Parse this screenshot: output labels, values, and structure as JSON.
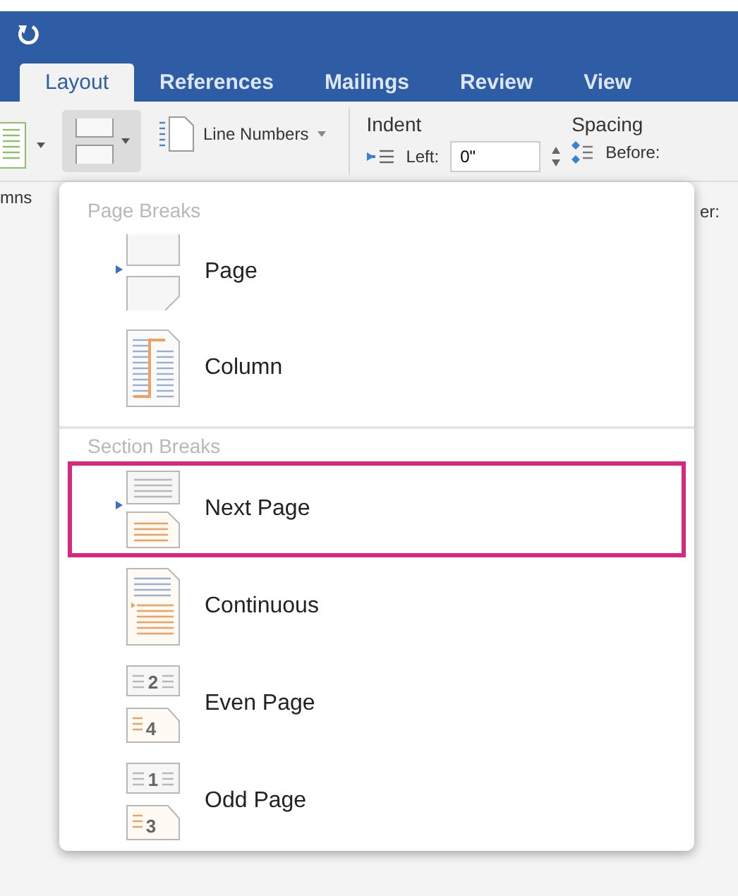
{
  "tabs": [
    {
      "label": "Layout",
      "selected": true
    },
    {
      "label": "References",
      "selected": false
    },
    {
      "label": "Mailings",
      "selected": false
    },
    {
      "label": "Review",
      "selected": false
    },
    {
      "label": "View",
      "selected": false
    }
  ],
  "ribbon": {
    "columns_label": "mns",
    "line_numbers": "Line Numbers",
    "indent": {
      "title": "Indent",
      "left_label": "Left:",
      "left_value": "0\""
    },
    "spacing": {
      "title": "Spacing",
      "before_label": "Before:",
      "after_label": "er:"
    }
  },
  "menu": {
    "sections": [
      {
        "title": "Page Breaks",
        "items": [
          {
            "kind": "page",
            "label": "Page",
            "highlighted": false
          },
          {
            "kind": "column",
            "label": "Column",
            "highlighted": false
          }
        ]
      },
      {
        "title": "Section Breaks",
        "items": [
          {
            "kind": "next_page",
            "label": "Next Page",
            "highlighted": true
          },
          {
            "kind": "continuous",
            "label": "Continuous",
            "highlighted": false
          },
          {
            "kind": "numbered",
            "label": "Even Page",
            "highlighted": false,
            "page_numbers": [
              "2",
              "4"
            ]
          },
          {
            "kind": "numbered",
            "label": "Odd Page",
            "highlighted": false,
            "page_numbers": [
              "1",
              "3"
            ]
          }
        ]
      }
    ]
  }
}
